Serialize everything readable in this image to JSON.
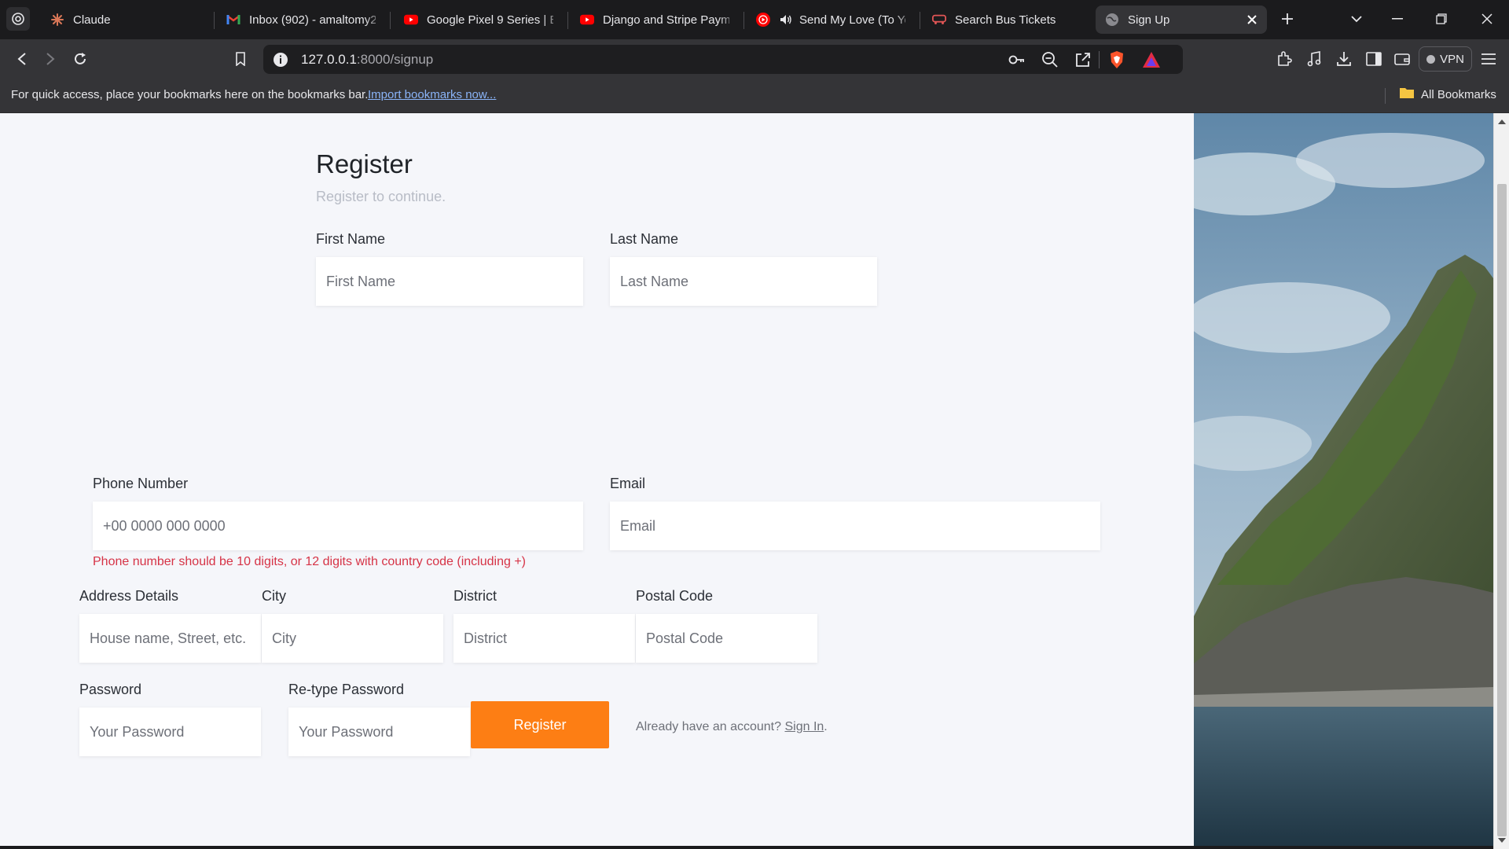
{
  "browser": {
    "tabs": [
      {
        "title": "Claude",
        "icon": "claude-icon",
        "active": false
      },
      {
        "title": "Inbox (902) - amaltomy2",
        "icon": "gmail-icon",
        "active": false
      },
      {
        "title": "Google Pixel 9 Series | Ev",
        "icon": "youtube-icon",
        "active": false
      },
      {
        "title": "Django and Stripe Payme",
        "icon": "youtube-icon",
        "active": false
      },
      {
        "title": "Send My Love (To Yo",
        "icon": "youtube-music-icon",
        "active": false
      },
      {
        "title": "Search Bus Tickets",
        "icon": "bus-icon",
        "active": false
      },
      {
        "title": "Sign Up",
        "icon": "globe-icon",
        "active": true
      }
    ],
    "url_host": "127.0.0.1",
    "url_rest": ":8000/signup",
    "vpn_label": "VPN",
    "bookmarks_message": "For quick access, place your bookmarks here on the bookmarks bar.",
    "bookmarks_link": "Import bookmarks now...",
    "all_bookmarks": "All Bookmarks"
  },
  "form": {
    "title": "Register",
    "subtitle": "Register to continue.",
    "first_name": {
      "label": "First Name",
      "placeholder": "First Name"
    },
    "last_name": {
      "label": "Last Name",
      "placeholder": "Last Name"
    },
    "phone": {
      "label": "Phone Number",
      "placeholder": "+00 0000 000 0000"
    },
    "email": {
      "label": "Email",
      "placeholder": "Email"
    },
    "phone_error": "Phone number should be 10 digits, or 12 digits with country code (including +)",
    "address": {
      "label": "Address Details",
      "placeholder": "House name, Street, etc."
    },
    "city": {
      "label": "City",
      "placeholder": "City"
    },
    "district": {
      "label": "District",
      "placeholder": "District"
    },
    "postal": {
      "label": "Postal Code",
      "placeholder": "Postal Code"
    },
    "password": {
      "label": "Password",
      "placeholder": "Your Password"
    },
    "retype_password": {
      "label": "Re-type Password",
      "placeholder": "Your Password"
    },
    "register_button": "Register",
    "signin_prompt": "Already have an account?",
    "signin_link": "Sign In",
    "signin_suffix": "."
  },
  "colors": {
    "accent": "#fd7e14",
    "error": "#d63346",
    "page_bg": "#f5f6fa"
  }
}
